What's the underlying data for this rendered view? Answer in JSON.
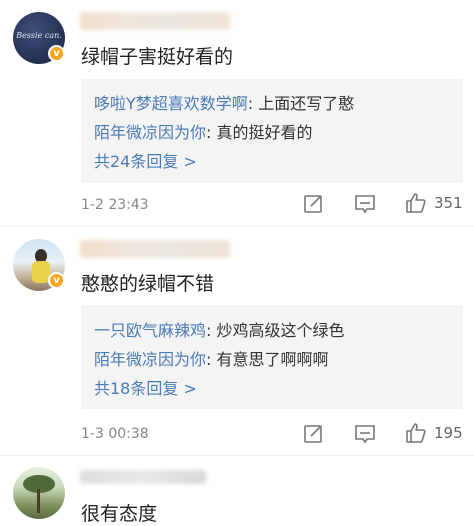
{
  "comments": [
    {
      "avatar_text": "Bessie can.",
      "text": "绿帽子害挺好看的",
      "replies": [
        {
          "name": "哆啦Y梦超喜欢数学啊",
          "sep": ": ",
          "text": "上面还写了憨"
        },
        {
          "name": "陌年微凉因为你",
          "sep": ": ",
          "text": "真的挺好看的"
        }
      ],
      "more": "共24条回复 >",
      "time": "1-2 23:43",
      "likes": "351"
    },
    {
      "text": "憨憨的绿帽不错",
      "replies": [
        {
          "name": "一只欧气麻辣鸡",
          "sep": ": ",
          "text": "炒鸡高级这个绿色"
        },
        {
          "name": "陌年微凉因为你",
          "sep": ": ",
          "text": "有意思了啊啊啊"
        }
      ],
      "more": "共18条回复 >",
      "time": "1-3 00:38",
      "likes": "195"
    },
    {
      "text": "很有态度"
    }
  ],
  "colors": {
    "link": "#4a7ab5",
    "verified": "#f5a623",
    "reply_bg": "#f4f4f4"
  }
}
